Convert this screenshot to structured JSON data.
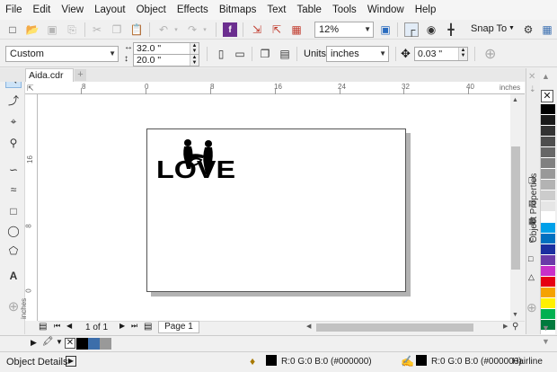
{
  "menu": {
    "items": [
      "File",
      "Edit",
      "View",
      "Layout",
      "Object",
      "Effects",
      "Bitmaps",
      "Text",
      "Table",
      "Tools",
      "Window",
      "Help"
    ]
  },
  "toolbar": {
    "zoom_value": "12%",
    "snap_label": "Snap To"
  },
  "property_bar": {
    "page_preset": "Custom",
    "width": "32.0 \"",
    "height": "20.0 \"",
    "units_label": "Units:",
    "units_value": "inches",
    "nudge": "0.03 \""
  },
  "document": {
    "tab_name": "Aida.cdr",
    "artwork_text": "LOVE"
  },
  "ruler": {
    "h_labels": [
      "8",
      "0",
      "8",
      "16",
      "24",
      "32",
      "40"
    ],
    "h_unit": "inches",
    "v_labels": [
      "16",
      "8",
      "0"
    ],
    "v_unit": "inches"
  },
  "docker": {
    "title": "Object Properties"
  },
  "navigator": {
    "page_count": "1 of 1",
    "page_tab": "Page 1"
  },
  "status": {
    "object_details": "Object Details",
    "fill_value": "R:0 G:0 B:0 (#000000)",
    "outline_value": "R:0 G:0 B:0 (#000000)",
    "outline_width": "Hairline"
  },
  "palette": {
    "colors": [
      "#000000",
      "#1a1a1a",
      "#333333",
      "#4d4d4d",
      "#666666",
      "#808080",
      "#999999",
      "#b3b3b3",
      "#cccccc",
      "#e6e6e6",
      "#ffffff",
      "#00a0e9",
      "#0070c0",
      "#1b2fa0",
      "#6a3aa8",
      "#c830c8",
      "#e60012",
      "#f5a200",
      "#fff000",
      "#00b050",
      "#007a3d"
    ],
    "recent": [
      "#000000",
      "#3c6eaa",
      "#999999"
    ]
  }
}
